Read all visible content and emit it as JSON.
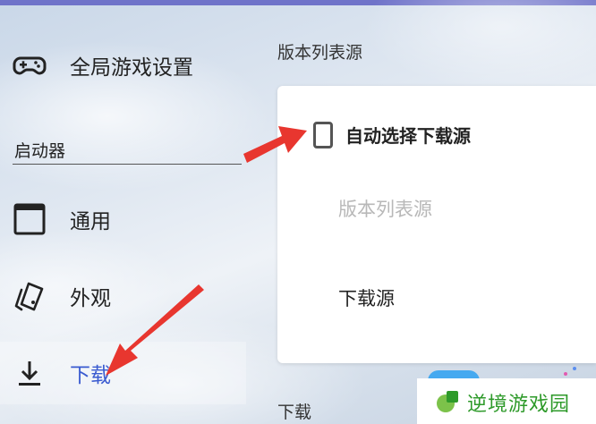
{
  "sidebar": {
    "global_item": {
      "label": "全局游戏设置",
      "icon": "gamepad-icon"
    },
    "section_label": "启动器",
    "items": [
      {
        "label": "通用",
        "icon": "window-icon"
      },
      {
        "label": "外观",
        "icon": "brush-icon"
      },
      {
        "label": "下载",
        "icon": "download-icon",
        "active": true
      }
    ]
  },
  "main": {
    "section_title": "版本列表源",
    "auto_select_label": "自动选择下载源",
    "auto_select_checked": false,
    "version_list_source_label": "版本列表源",
    "download_source_label": "下载源",
    "next_section_title": "下载"
  },
  "watermark": {
    "text": "逆境游戏园"
  },
  "colors": {
    "accent": "#3a5bd0",
    "arrow": "#e8362f",
    "top_bar": "#6f73c9",
    "watermark_text": "#2e9a2a"
  }
}
